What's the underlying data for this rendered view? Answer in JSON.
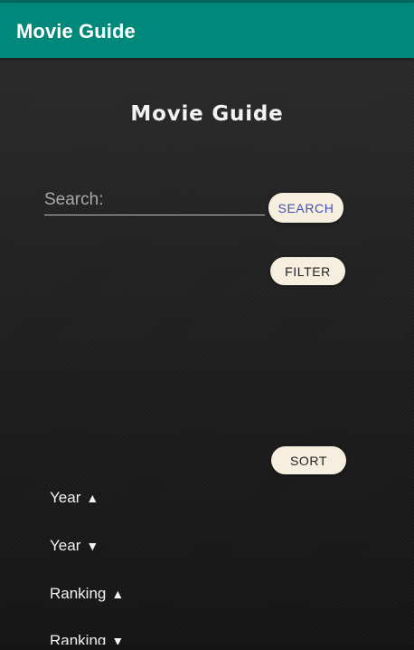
{
  "app_bar": {
    "title": "Movie Guide"
  },
  "main": {
    "title": "Movie Guide",
    "search": {
      "placeholder": "Search:",
      "value": ""
    },
    "search_button_label": "SEARCH",
    "filter_button_label": "FILTER",
    "sort_button_label": "SORT",
    "sort_options": [
      {
        "label": "Year",
        "arrow": "▲"
      },
      {
        "label": "Year",
        "arrow": "▼"
      },
      {
        "label": "Ranking",
        "arrow": "▲"
      },
      {
        "label": "Ranking",
        "arrow": "▼"
      }
    ]
  },
  "colors": {
    "app_bar": "#00897b",
    "button_bg": "#f6efdf",
    "search_button_text": "#3f51b5",
    "background": "#1c1c1c"
  }
}
